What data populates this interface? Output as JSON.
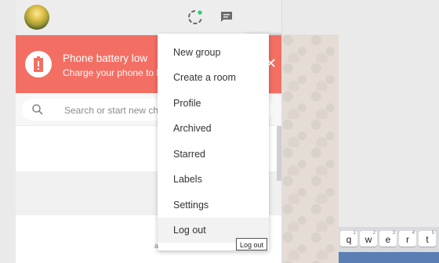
{
  "header": {
    "avatar_alt": "Profile picture",
    "icons": [
      "status-icon",
      "new-chat-icon",
      "menu-icon"
    ]
  },
  "banner": {
    "title": "Phone battery low",
    "subtitle": "Charge your phone to ke",
    "icon": "battery-alert-icon",
    "close_glyph": "✕"
  },
  "search": {
    "placeholder": "Search or start new chat",
    "icon": "search-icon"
  },
  "menu": {
    "items": [
      {
        "label": "New group"
      },
      {
        "label": "Create a room"
      },
      {
        "label": "Profile"
      },
      {
        "label": "Archived"
      },
      {
        "label": "Starred"
      },
      {
        "label": "Labels"
      },
      {
        "label": "Settings"
      },
      {
        "label": "Log out"
      }
    ]
  },
  "tooltip": {
    "text": "Log out",
    "fragment": "a"
  },
  "keyboard": {
    "keys": [
      {
        "letter": "q",
        "num": "1"
      },
      {
        "letter": "w",
        "num": "2"
      },
      {
        "letter": "e",
        "num": "3"
      },
      {
        "letter": "r",
        "num": "4"
      },
      {
        "letter": "t",
        "num": "5"
      }
    ]
  },
  "colors": {
    "banner": "#f36f64",
    "header": "#ededed",
    "status_dot": "#25d366",
    "chat_bg": "#e5ddd5"
  }
}
